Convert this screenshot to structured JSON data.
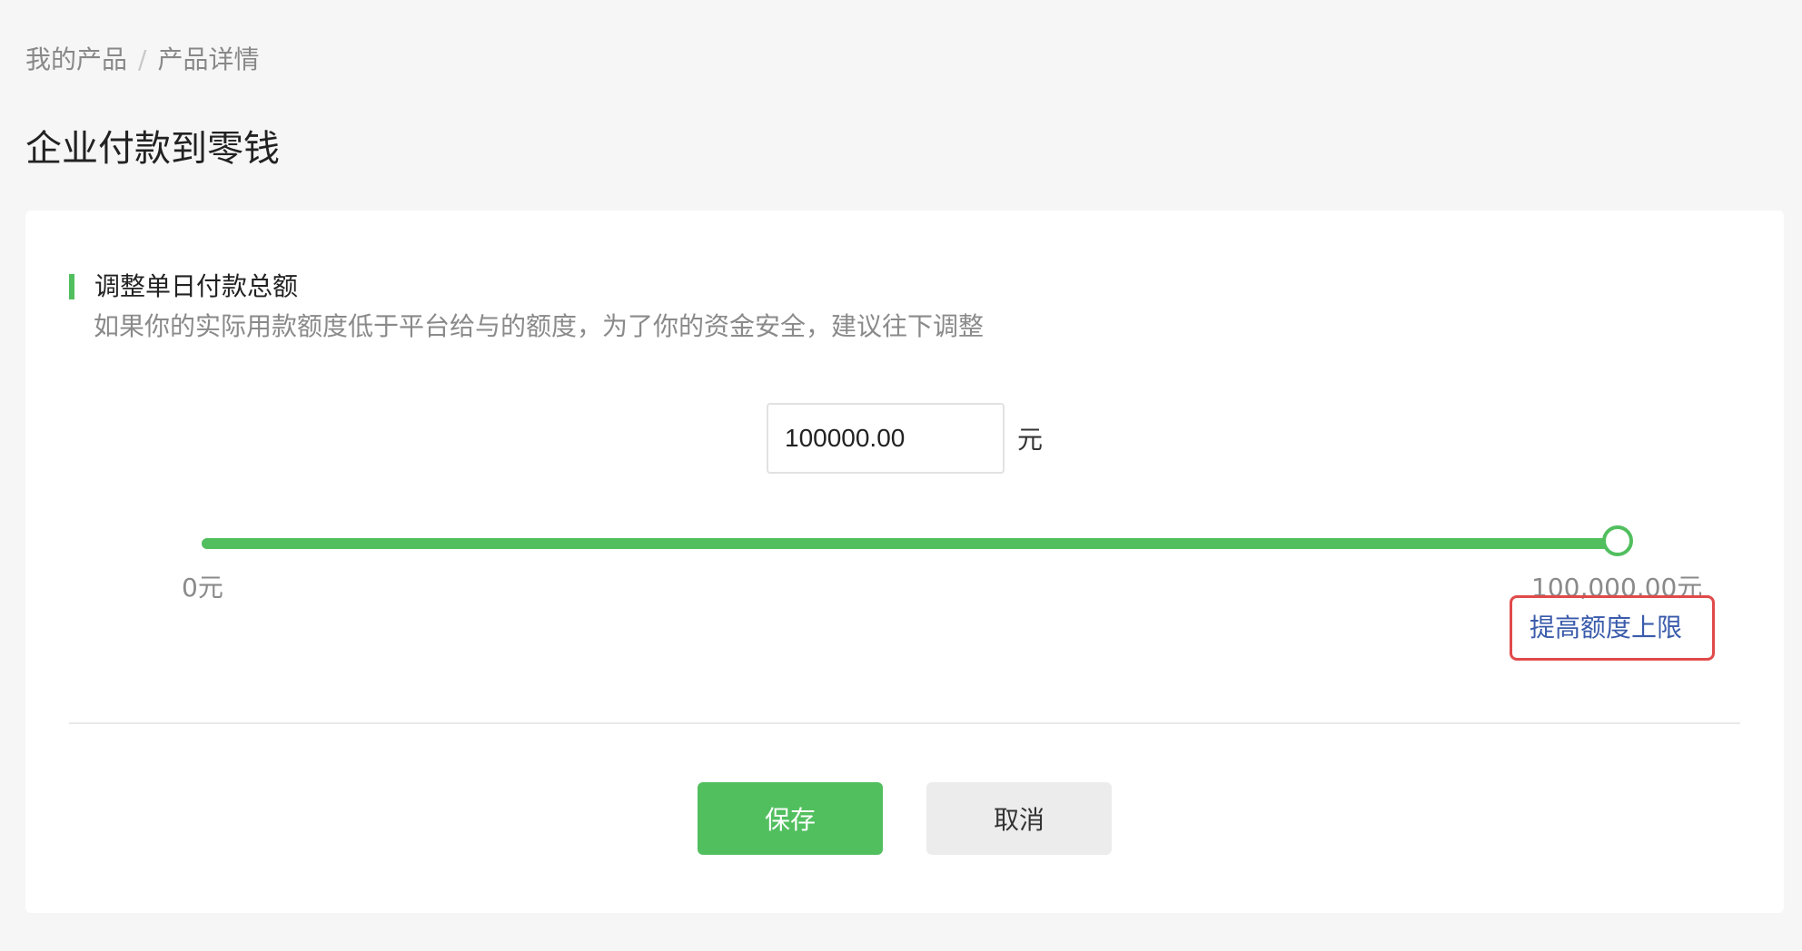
{
  "breadcrumb": {
    "items": [
      "我的产品",
      "产品详情"
    ],
    "separator": "/"
  },
  "page": {
    "title": "企业付款到零钱"
  },
  "section": {
    "title": "调整单日付款总额",
    "description": "如果你的实际用款额度低于平台给与的额度，为了你的资金安全，建议往下调整"
  },
  "amount": {
    "value": "100000.00",
    "unit": "元"
  },
  "slider": {
    "min_label": "0元",
    "max_label": "100,000.00元",
    "fill_fraction": 1.0
  },
  "raise_limit": {
    "label": "提高额度上限"
  },
  "actions": {
    "save_label": "保存",
    "cancel_label": "取消"
  },
  "colors": {
    "accent": "#52bf5f",
    "link": "#3a5bab",
    "highlight_border": "#e14a4a"
  }
}
